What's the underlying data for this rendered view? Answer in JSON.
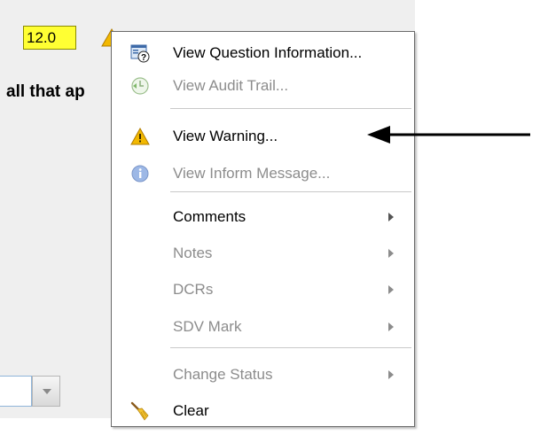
{
  "form": {
    "value": "12.0",
    "question_text": "all that ap"
  },
  "menu": {
    "items": [
      {
        "label": "View Question Information...",
        "icon": "question-info-icon"
      },
      {
        "label": "View Audit Trail...",
        "icon": "audit-trail-icon"
      },
      {
        "label": "View Warning...",
        "icon": "warning-icon"
      },
      {
        "label": "View Inform Message...",
        "icon": "info-icon"
      },
      {
        "label": "Comments",
        "submenu": true
      },
      {
        "label": "Notes",
        "submenu": true
      },
      {
        "label": "DCRs",
        "submenu": true
      },
      {
        "label": "SDV Mark",
        "submenu": true
      },
      {
        "label": "Change Status",
        "submenu": true
      },
      {
        "label": "Clear",
        "icon": "broom-icon"
      }
    ]
  },
  "colors": {
    "value_highlight": "#ffff33",
    "warning": "#f2b800",
    "disabled_text": "#8c8c8c"
  }
}
